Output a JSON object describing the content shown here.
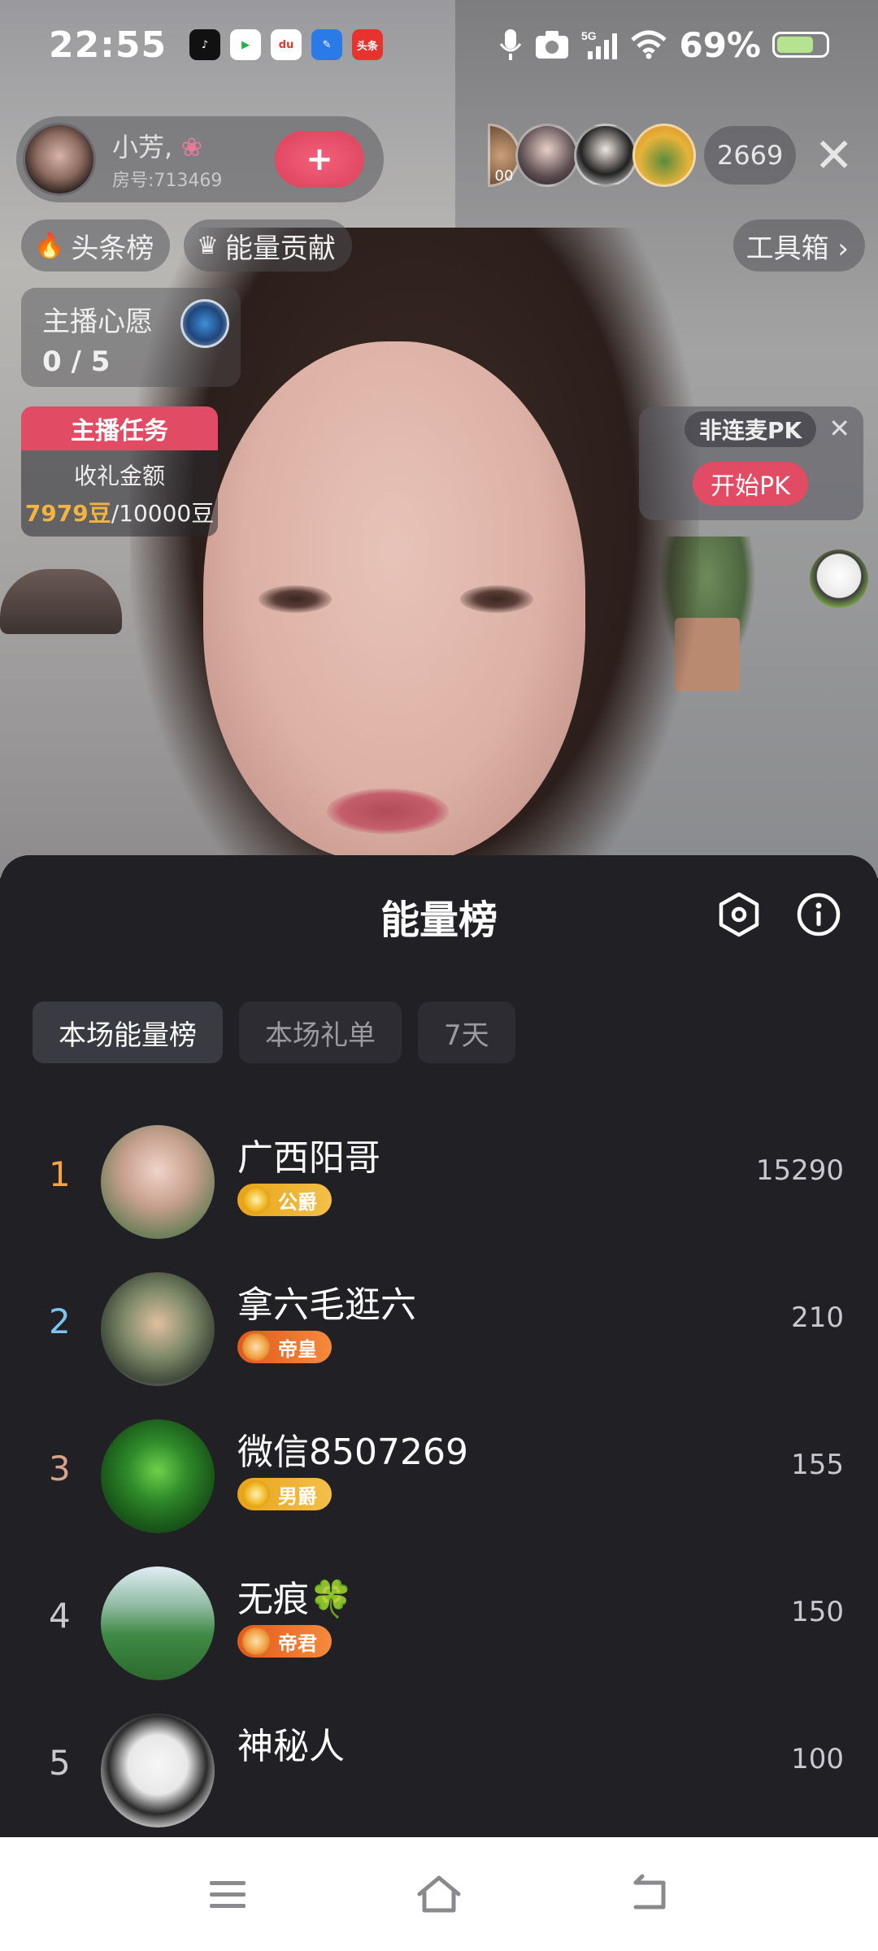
{
  "status_bar": {
    "time": "22:55",
    "network": "5G",
    "battery": "69%",
    "battery_level": 0.69,
    "apps": [
      "tiktok-icon",
      "play-icon",
      "map-icon",
      "feather-icon",
      "toutiao-icon"
    ],
    "toutiao_label": "头条",
    "du_label": "du"
  },
  "host": {
    "name": "小芳,",
    "room": "房号:713469",
    "follow_label": "+"
  },
  "viewers": {
    "count": "2669",
    "partial_badge": "00"
  },
  "chips": {
    "headline": "头条榜",
    "energy": "能量贡献",
    "tools": "工具箱 ›"
  },
  "wish": {
    "title": "主播心愿",
    "count": "0 / 5"
  },
  "task": {
    "title": "主播任务",
    "label": "收礼金额",
    "current": "7979豆",
    "target": "/10000豆"
  },
  "pk": {
    "tag": "非连麦PK",
    "button": "开始PK"
  },
  "board": {
    "title": "能量榜",
    "tabs": [
      "本场能量榜",
      "本场礼单",
      "7天"
    ],
    "rows": [
      {
        "rank": "1",
        "name": "广西阳哥",
        "badge": "公爵",
        "score": "15290"
      },
      {
        "rank": "2",
        "name": "拿六毛逛六",
        "badge": "帝皇",
        "score": "210"
      },
      {
        "rank": "3",
        "name": "微信8507269",
        "badge": "男爵",
        "score": "155"
      },
      {
        "rank": "4",
        "name": "无痕🍀",
        "badge": "帝君",
        "score": "150"
      },
      {
        "rank": "5",
        "name": "神秘人",
        "badge": "",
        "score": "100"
      }
    ]
  },
  "colors": {
    "accent": "#e14b63",
    "rank1": "#f2a541",
    "rank2": "#7fc4f0",
    "rank3": "#d9a38a",
    "rank_other": "#c8c8ce"
  }
}
